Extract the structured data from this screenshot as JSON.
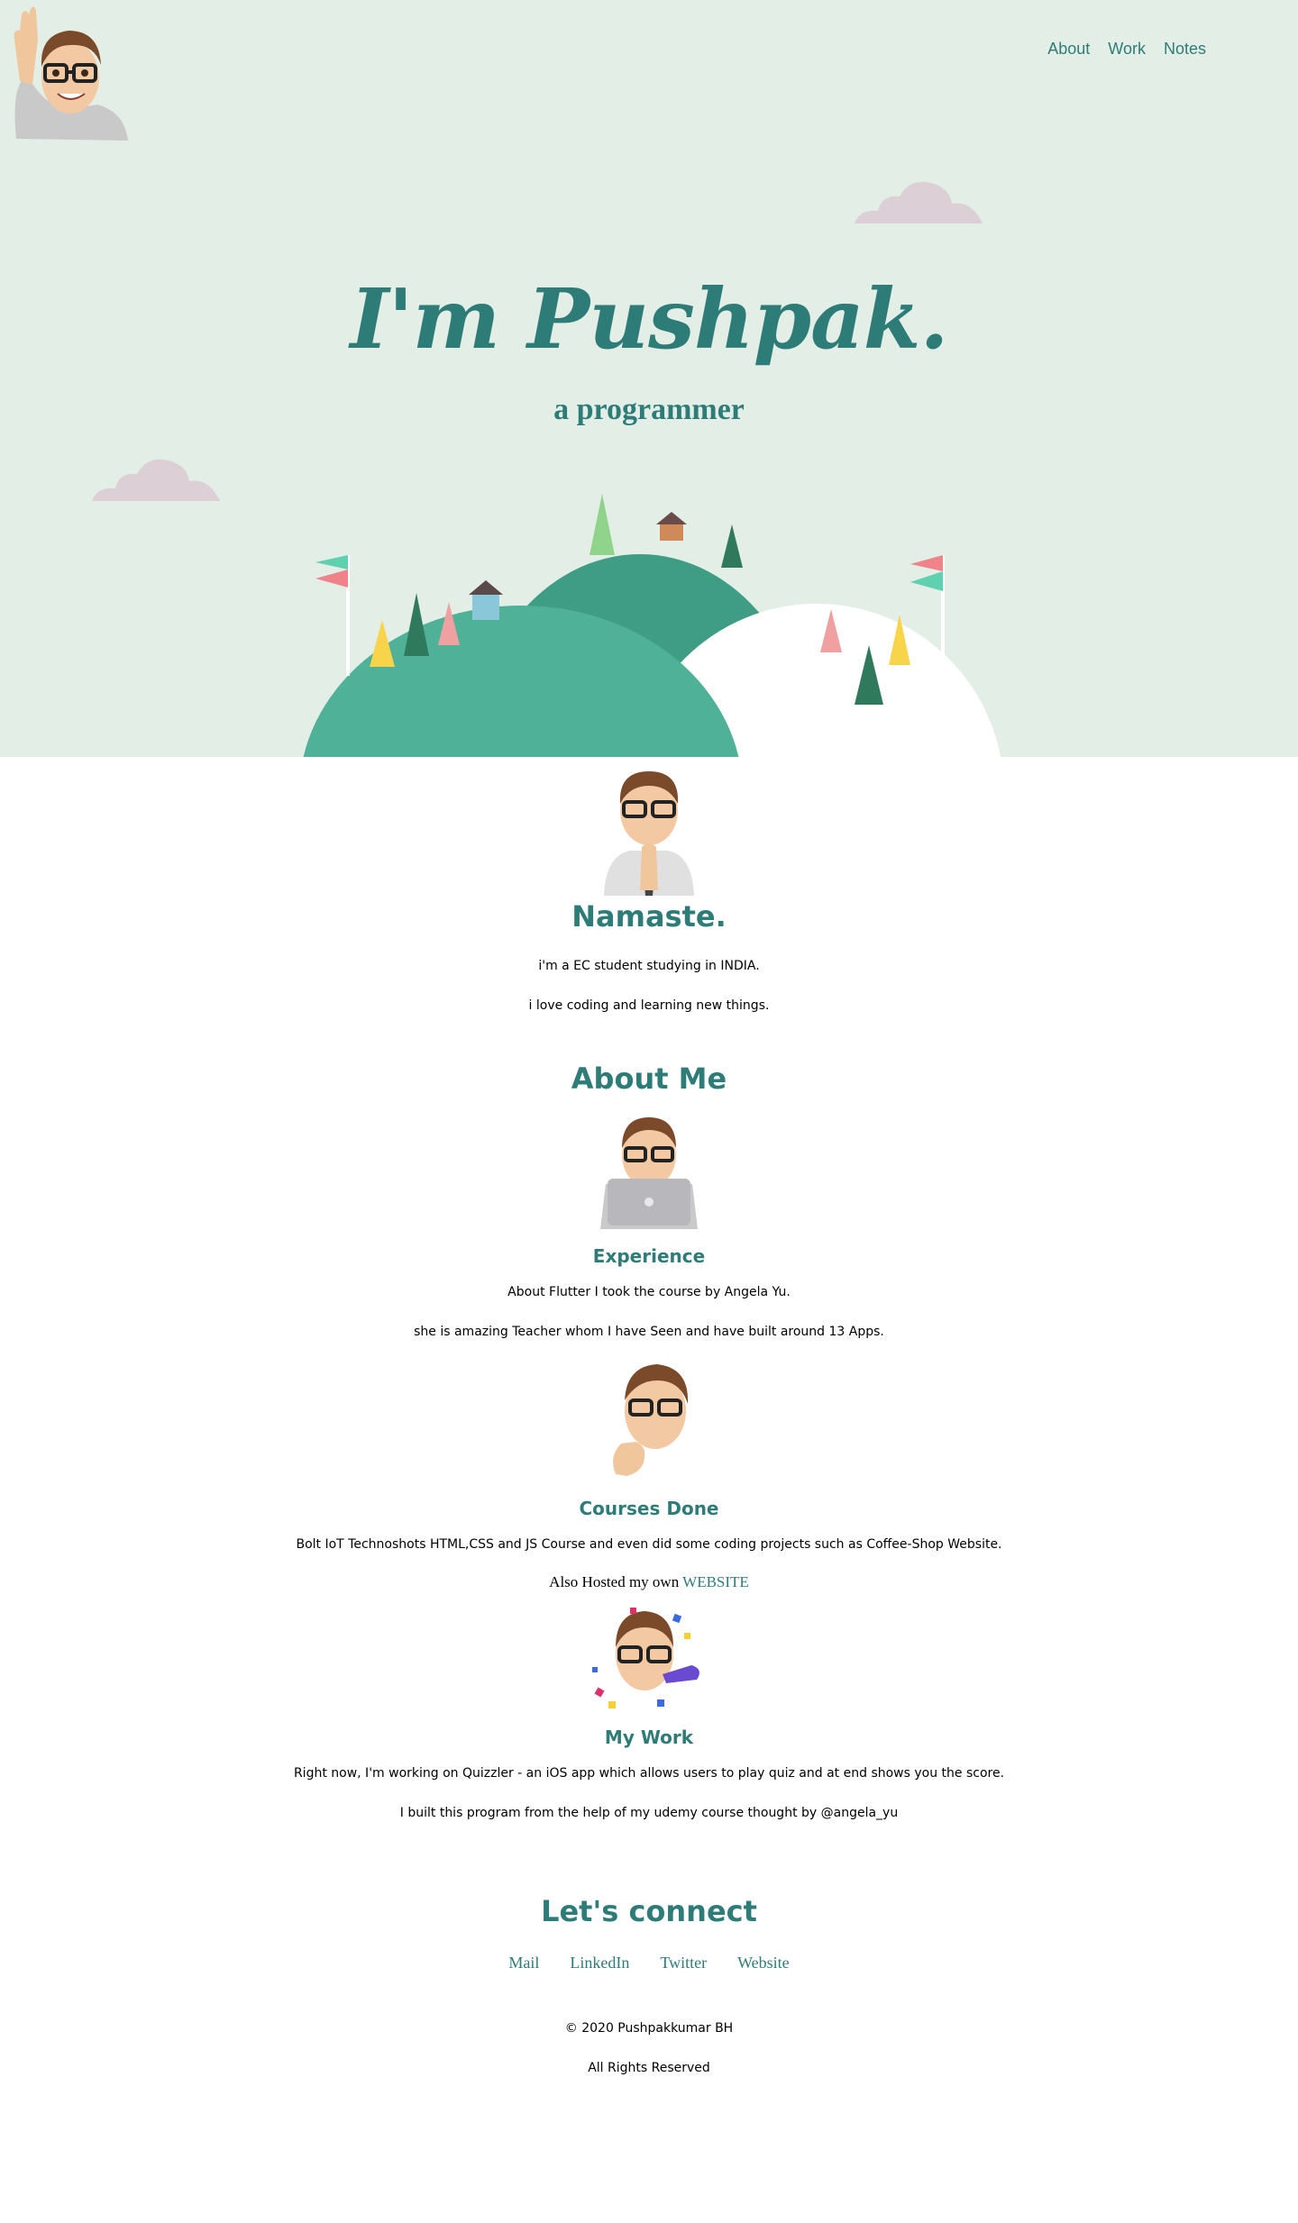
{
  "nav": {
    "items": [
      "About",
      "Work",
      "Notes"
    ]
  },
  "hero": {
    "title": "I'm Pushpak.",
    "subtitle": "a programmer"
  },
  "namaste": {
    "title": "Namaste.",
    "lines": [
      "i'm a EC student studying in INDIA.",
      "i love coding and learning new things."
    ]
  },
  "about": {
    "title": "About Me",
    "experience": {
      "title": "Experience",
      "lines": [
        "About Flutter I took the course by Angela Yu.",
        "she is amazing Teacher whom I have Seen and have built around 13 Apps."
      ]
    },
    "courses": {
      "title": "Courses Done",
      "line": "Bolt IoT Technoshots HTML,CSS and JS Course and even did some coding projects such as Coffee-Shop Website.",
      "hosted_text": "Also Hosted my own",
      "hosted_link": "WEBSITE"
    },
    "work": {
      "title": "My Work",
      "lines": [
        "Right now, I'm working on Quizzler - an iOS app which allows users to play quiz and at end shows you the score.",
        "I built this program from the help of my udemy course thought by @angela_yu"
      ]
    }
  },
  "connect": {
    "title": "Let's connect",
    "links": [
      "Mail",
      "LinkedIn",
      "Twitter",
      "Website"
    ]
  },
  "footer": {
    "copyright": "© 2020 Pushpakkumar BH",
    "rights": "All Rights Reserved"
  },
  "colors": {
    "accent": "#2e7c78",
    "hero_bg": "#e3efe6",
    "hill_dark": "#3f9d86",
    "hill_light": "#4fb198",
    "cloud": "#dccfd6"
  }
}
